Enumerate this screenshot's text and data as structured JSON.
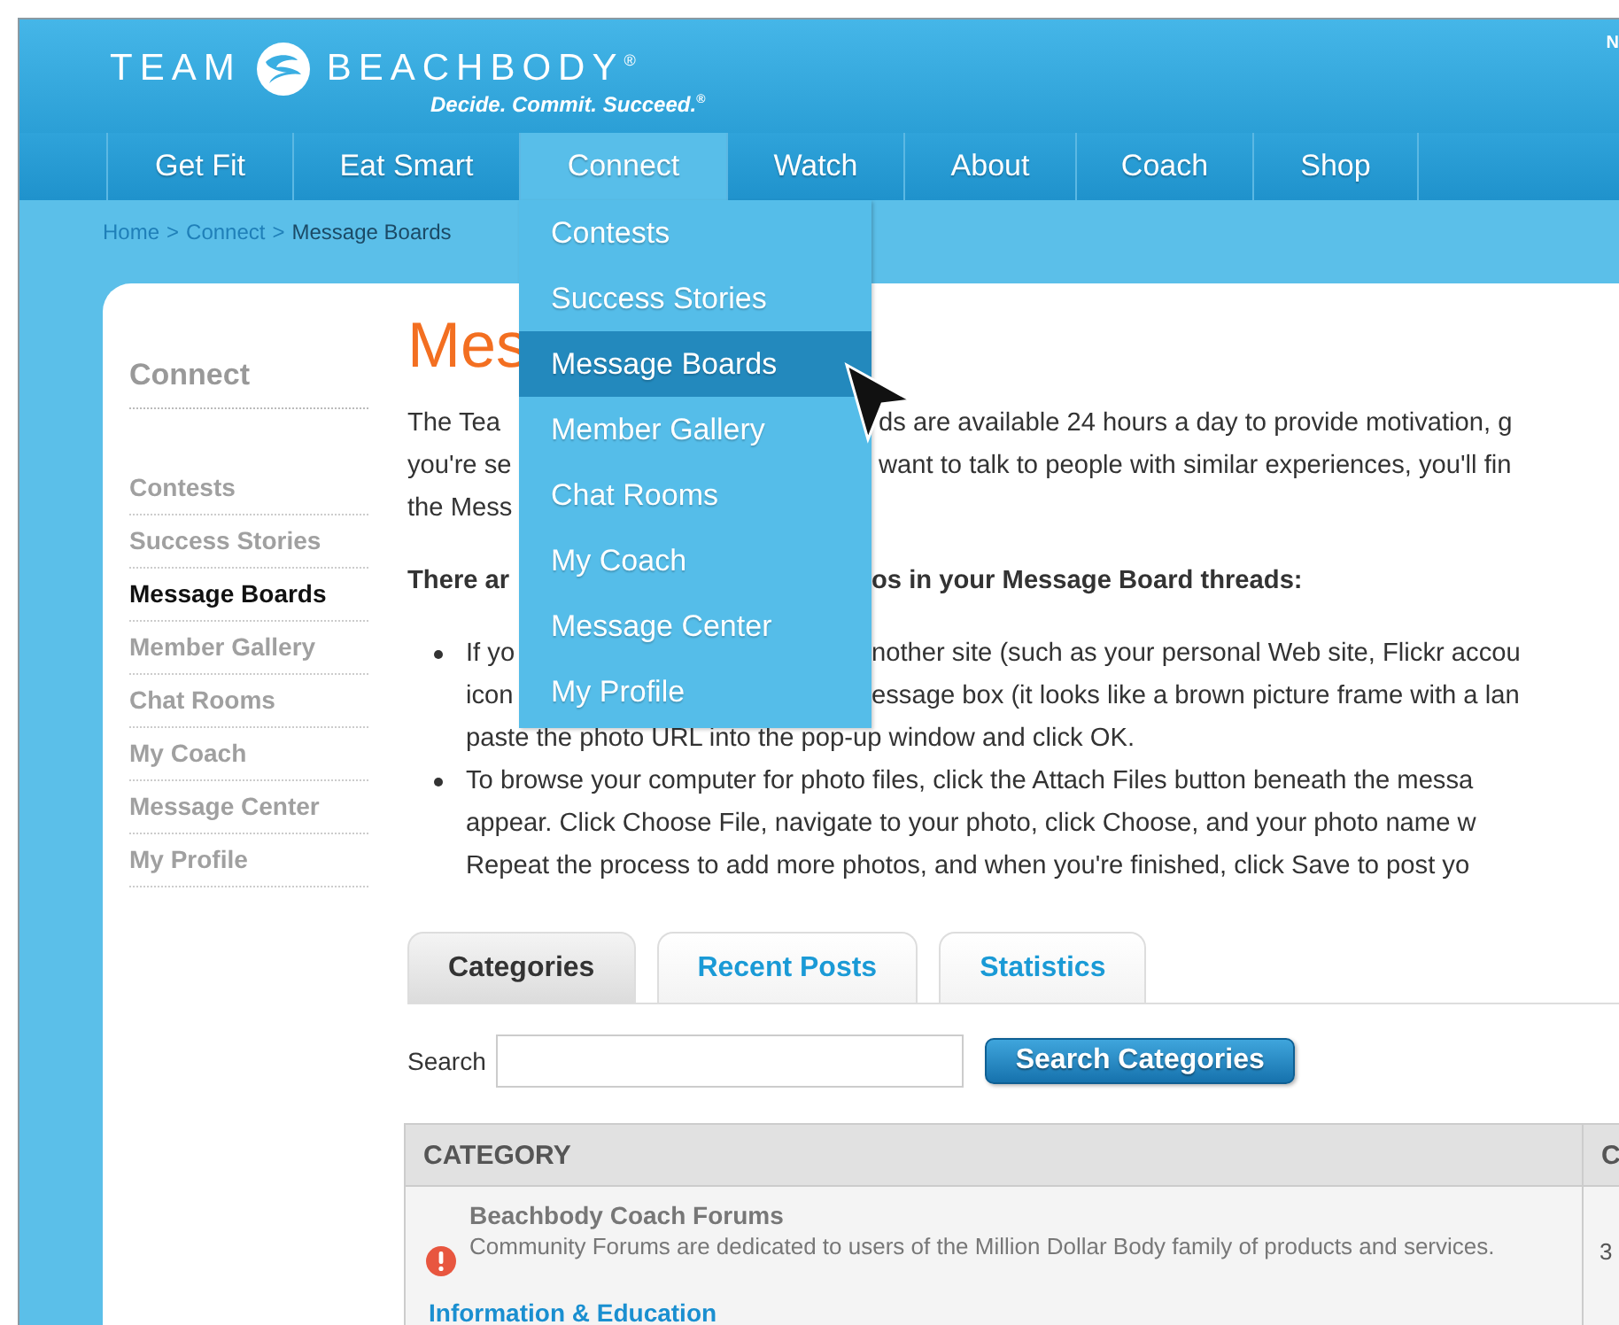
{
  "header": {
    "brand_left": "TEAM",
    "brand_right": "BEACHBODY$^{®}$",
    "tagline": "Decide. Commit. Succeed.$^{®}$",
    "corner_text": "N"
  },
  "nav": [
    {
      "label": "Get Fit",
      "selected": false
    },
    {
      "label": "Eat Smart",
      "selected": false
    },
    {
      "label": "Connect",
      "selected": true
    },
    {
      "label": "Watch",
      "selected": false
    },
    {
      "label": "About",
      "selected": false
    },
    {
      "label": "Coach",
      "selected": false
    },
    {
      "label": "Shop",
      "selected": false
    }
  ],
  "dropdown": [
    {
      "label": "Contests",
      "selected": false
    },
    {
      "label": "Success Stories",
      "selected": false
    },
    {
      "label": "Message Boards",
      "selected": true
    },
    {
      "label": "Member Gallery",
      "selected": false
    },
    {
      "label": "Chat Rooms",
      "selected": false
    },
    {
      "label": "My Coach",
      "selected": false
    },
    {
      "label": "Message Center",
      "selected": false
    },
    {
      "label": "My Profile",
      "selected": false
    }
  ],
  "breadcrumb": [
    {
      "label": "Home",
      "kind": "link"
    },
    {
      "label": ">",
      "kind": "separator"
    },
    {
      "label": "Connect",
      "kind": "link"
    },
    {
      "label": ">",
      "kind": "separator"
    },
    {
      "label": "Message Boards",
      "kind": "current"
    }
  ],
  "sidebar": {
    "title": "Connect",
    "items": [
      {
        "label": "Contests",
        "selected": false
      },
      {
        "label": "Success Stories",
        "selected": false
      },
      {
        "label": "Message Boards",
        "selected": true
      },
      {
        "label": "Member Gallery",
        "selected": false
      },
      {
        "label": "Chat Rooms",
        "selected": false
      },
      {
        "label": "My Coach",
        "selected": false
      },
      {
        "label": "Message Center",
        "selected": false
      },
      {
        "label": "My Profile",
        "selected": false
      }
    ]
  },
  "main": {
    "title": "Mes",
    "intro_lines": [
      {
        "left": "The Tea",
        "right": "ds are available 24 hours a day to provide motivation, g"
      },
      {
        "left": "you're se",
        "right": "want to talk to people with similar experiences, you'll fin"
      },
      {
        "left": "the Mess"
      }
    ],
    "tips_heading": {
      "left": "There ar",
      "right": "os in your Message Board threads:"
    },
    "bullets": [
      {
        "lines": [
          {
            "left": "If yo",
            "right": "nother site (such as your personal Web site, Flickr accou"
          },
          {
            "left": "icon",
            "right": "essage box (it looks like a brown picture frame with a lan"
          },
          {
            "left": "paste the photo URL into the pop-up window and click OK."
          }
        ]
      },
      {
        "lines": [
          {
            "left": "To browse your computer for photo files, click the Attach Files button beneath the messa"
          },
          {
            "left": "appear. Click Choose File, navigate to your photo, click Choose, and your photo name w"
          },
          {
            "left": "Repeat the process to add more photos, and when you're finished, click Save to post yo"
          }
        ]
      }
    ]
  },
  "tabs": [
    {
      "label": "Categories",
      "selected": true
    },
    {
      "label": "Recent Posts",
      "selected": false
    },
    {
      "label": "Statistics",
      "selected": false
    }
  ],
  "search": {
    "label": "Search",
    "button": "Search Categories"
  },
  "table": {
    "columns": [
      "CATEGORY",
      "C"
    ],
    "rows": [
      {
        "kind": "forum",
        "alert": true,
        "title": "Beachbody Coach Forums",
        "description": "Community Forums are dedicated to users of the Million Dollar Body family of products and services.",
        "column_2": "3"
      },
      {
        "kind": "section",
        "title": "Information & Education"
      }
    ]
  }
}
